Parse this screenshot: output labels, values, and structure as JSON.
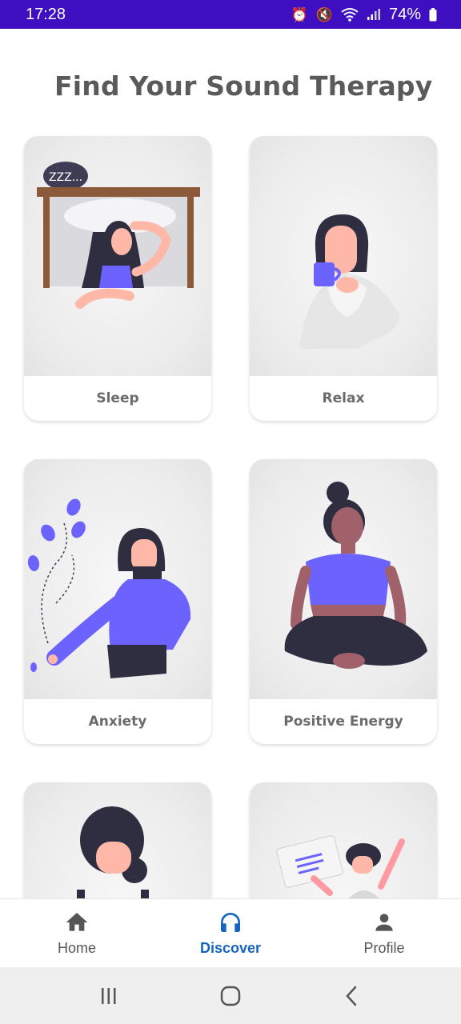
{
  "status_bar": {
    "time": "17:28",
    "battery": "74%",
    "icons": [
      "alarm-icon",
      "mute-icon",
      "wifi-icon",
      "signal-icon",
      "battery-icon"
    ]
  },
  "page": {
    "title": "Find Your Sound Therapy"
  },
  "cards": [
    {
      "label": "Sleep",
      "illustration": "woman-sleeping-in-bed"
    },
    {
      "label": "Relax",
      "illustration": "woman-drinking-coffee"
    },
    {
      "label": "Anxiety",
      "illustration": "woman-with-plant"
    },
    {
      "label": "Positive Energy",
      "illustration": "woman-meditating"
    },
    {
      "label": "",
      "illustration": "woman-with-bun"
    },
    {
      "label": "",
      "illustration": "person-with-document-cheering"
    }
  ],
  "bottom_nav": {
    "items": [
      {
        "label": "Home",
        "icon": "home-icon",
        "active": false
      },
      {
        "label": "Discover",
        "icon": "headphones-icon",
        "active": true
      },
      {
        "label": "Profile",
        "icon": "person-icon",
        "active": false
      }
    ]
  },
  "system_nav": [
    "recent-apps-icon",
    "home-circle-icon",
    "back-icon"
  ],
  "colors": {
    "status_bar": "#3d0fc0",
    "accent": "#1565c0",
    "illustration_purple": "#6c63ff",
    "title": "#5a5a5a"
  }
}
